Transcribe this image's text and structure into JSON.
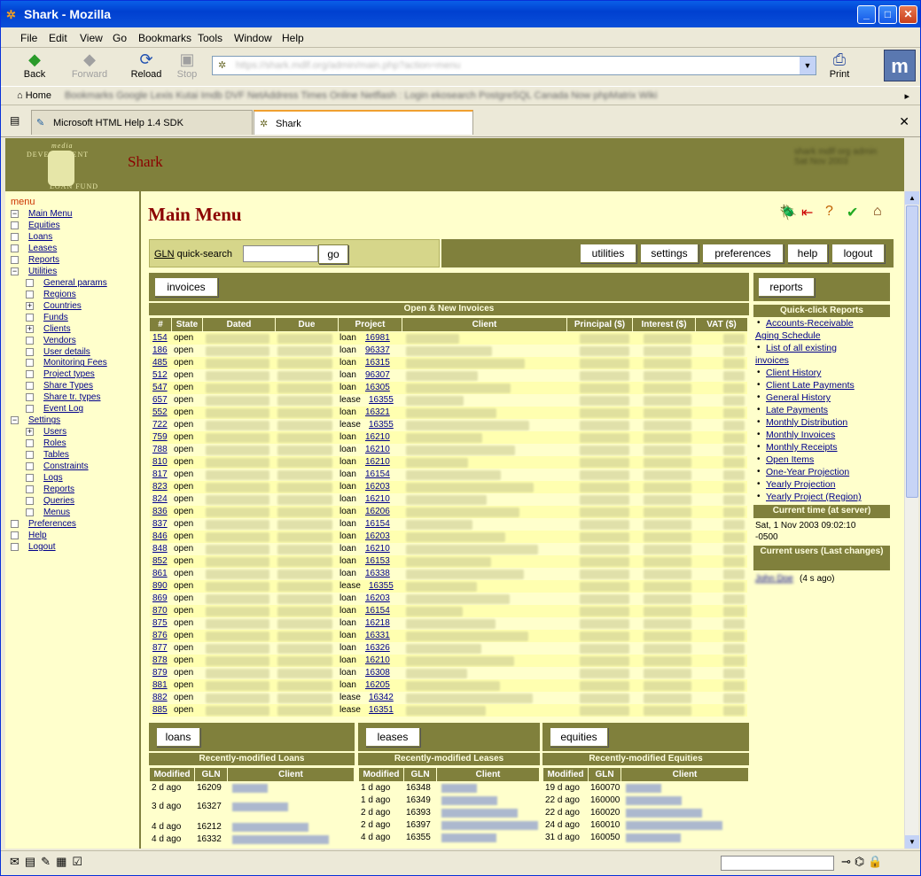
{
  "window": {
    "title": "Shark - Mozilla"
  },
  "menu": [
    "File",
    "Edit",
    "View",
    "Go",
    "Bookmarks",
    "Tools",
    "Window",
    "Help"
  ],
  "nav": {
    "back": "Back",
    "forward": "Forward",
    "reload": "Reload",
    "stop": "Stop",
    "print": "Print",
    "url": "https://shark.mdlf.org/admin/main.php?action=menu"
  },
  "bookmarks": {
    "home": "Home",
    "items": "Bookmarks  Google  Lexis  Kutai  Imdb  DVF  NetAddress  Times Online  Netflash : Login  ekosearch  PostgreSQL  Canada Now  phpMatrix  Wiki"
  },
  "tabs": [
    {
      "label": "Microsoft HTML Help 1.4 SDK"
    },
    {
      "label": "Shark"
    }
  ],
  "banner": {
    "logo_l1": "media",
    "logo_l2": "DEVELOPMENT",
    "logo_l3": "LOAN FUND",
    "app": "Shark",
    "right": "shark mdlf org  admin  Sat Nov 2003"
  },
  "sidebar": {
    "header": "menu",
    "items": [
      {
        "label": "Main Menu",
        "box": "−",
        "lvl": 0
      },
      {
        "label": "Equities",
        "box": "",
        "lvl": 0
      },
      {
        "label": "Loans",
        "box": "",
        "lvl": 0
      },
      {
        "label": "Leases",
        "box": "",
        "lvl": 0
      },
      {
        "label": "Reports",
        "box": "",
        "lvl": 0
      },
      {
        "label": "Utilities",
        "box": "−",
        "lvl": 0
      },
      {
        "label": "General params",
        "box": "",
        "lvl": 1
      },
      {
        "label": "Regions",
        "box": "",
        "lvl": 1
      },
      {
        "label": "Countries",
        "box": "+",
        "lvl": 1
      },
      {
        "label": "Funds",
        "box": "",
        "lvl": 1
      },
      {
        "label": "Clients",
        "box": "+",
        "lvl": 1
      },
      {
        "label": "Vendors",
        "box": "",
        "lvl": 1
      },
      {
        "label": "User details",
        "box": "",
        "lvl": 1
      },
      {
        "label": "Monitoring Fees",
        "box": "",
        "lvl": 1
      },
      {
        "label": "Project types",
        "box": "",
        "lvl": 1
      },
      {
        "label": "Share Types",
        "box": "",
        "lvl": 1
      },
      {
        "label": "Share tr. types",
        "box": "",
        "lvl": 1
      },
      {
        "label": "Event Log",
        "box": "",
        "lvl": 1
      },
      {
        "label": "Settings",
        "box": "−",
        "lvl": 0
      },
      {
        "label": "Users",
        "box": "+",
        "lvl": 1
      },
      {
        "label": "Roles",
        "box": "",
        "lvl": 1
      },
      {
        "label": "Tables",
        "box": "",
        "lvl": 1
      },
      {
        "label": "Constraints",
        "box": "",
        "lvl": 1
      },
      {
        "label": "Logs",
        "box": "",
        "lvl": 1
      },
      {
        "label": "Reports",
        "box": "",
        "lvl": 1
      },
      {
        "label": "Queries",
        "box": "",
        "lvl": 1
      },
      {
        "label": "Menus",
        "box": "",
        "lvl": 1
      },
      {
        "label": "Preferences",
        "box": "",
        "lvl": 0
      },
      {
        "label": "Help",
        "box": "",
        "lvl": 0
      },
      {
        "label": "Logout",
        "box": "",
        "lvl": 0
      }
    ]
  },
  "main": {
    "title": "Main Menu",
    "quicksearch": {
      "gln": "GLN",
      "label": " quick-search",
      "go": "go",
      "value": ""
    },
    "toolbar": [
      "utilities",
      "settings",
      "preferences",
      "help",
      "logout"
    ],
    "invoices": {
      "button": "invoices",
      "subtitle": "Open & New Invoices",
      "headers": [
        "#",
        "State",
        "Dated",
        "Due",
        "Project",
        "Client",
        "Principal ($)",
        "Interest ($)",
        "VAT ($)"
      ],
      "rows": [
        [
          "154",
          "open",
          "loan",
          "16981"
        ],
        [
          "186",
          "open",
          "loan",
          "96337"
        ],
        [
          "485",
          "open",
          "loan",
          "16315"
        ],
        [
          "512",
          "open",
          "loan",
          "96307"
        ],
        [
          "547",
          "open",
          "loan",
          "16305"
        ],
        [
          "657",
          "open",
          "lease",
          "16355"
        ],
        [
          "552",
          "open",
          "loan",
          "16321"
        ],
        [
          "722",
          "open",
          "lease",
          "16355"
        ],
        [
          "759",
          "open",
          "loan",
          "16210"
        ],
        [
          "788",
          "open",
          "loan",
          "16210"
        ],
        [
          "810",
          "open",
          "loan",
          "16210"
        ],
        [
          "817",
          "open",
          "loan",
          "16154"
        ],
        [
          "823",
          "open",
          "loan",
          "16203"
        ],
        [
          "824",
          "open",
          "loan",
          "16210"
        ],
        [
          "836",
          "open",
          "loan",
          "16206"
        ],
        [
          "837",
          "open",
          "loan",
          "16154"
        ],
        [
          "846",
          "open",
          "loan",
          "16203"
        ],
        [
          "848",
          "open",
          "loan",
          "16210"
        ],
        [
          "852",
          "open",
          "loan",
          "16153"
        ],
        [
          "861",
          "open",
          "loan",
          "16338"
        ],
        [
          "890",
          "open",
          "lease",
          "16355"
        ],
        [
          "869",
          "open",
          "loan",
          "16203"
        ],
        [
          "870",
          "open",
          "loan",
          "16154"
        ],
        [
          "875",
          "open",
          "loan",
          "16218"
        ],
        [
          "876",
          "open",
          "loan",
          "16331"
        ],
        [
          "877",
          "open",
          "loan",
          "16326"
        ],
        [
          "878",
          "open",
          "loan",
          "16210"
        ],
        [
          "879",
          "open",
          "loan",
          "16308"
        ],
        [
          "881",
          "open",
          "loan",
          "16205"
        ],
        [
          "882",
          "open",
          "lease",
          "16342"
        ],
        [
          "885",
          "open",
          "lease",
          "16351"
        ]
      ]
    },
    "reports": {
      "button": "reports",
      "subtitle": "Quick-click Reports",
      "links": [
        "Accounts-Receivable",
        "Aging Schedule",
        "List of all existing",
        "invoices",
        "Client History",
        "Client Late Payments",
        "General History",
        "Late Payments",
        "Monthly Distribution",
        "Monthly Invoices",
        "Monthly Receipts",
        "Open Items",
        "One-Year Projection",
        "Yearly Projection",
        "Yearly Project (Region)"
      ],
      "time_hd": "Current time (at server)",
      "time": "Sat, 1 Nov 2003 09:02:10",
      "tz": "-0500",
      "users_hd": "Current users (Last changes)",
      "user": "John Doe",
      "user_ago": " (4 s ago)"
    },
    "loans": {
      "button": "loans",
      "subtitle": "Recently-modified Loans",
      "headers": [
        "Modified",
        "GLN",
        "Client"
      ],
      "rows": [
        [
          "2 d ago",
          "16209"
        ],
        [
          "3 d ago",
          "16327"
        ],
        [
          "4 d ago",
          "16212"
        ],
        [
          "4 d ago",
          "16332"
        ]
      ]
    },
    "leases": {
      "button": "leases",
      "subtitle": "Recently-modified Leases",
      "headers": [
        "Modified",
        "GLN",
        "Client"
      ],
      "rows": [
        [
          "1 d ago",
          "16348"
        ],
        [
          "1 d ago",
          "16349"
        ],
        [
          "2 d ago",
          "16393"
        ],
        [
          "2 d ago",
          "16397"
        ],
        [
          "4 d ago",
          "16355"
        ]
      ]
    },
    "equities": {
      "button": "equities",
      "subtitle": "Recently-modified Equities",
      "headers": [
        "Modified",
        "GLN",
        "Client"
      ],
      "rows": [
        [
          "19 d ago",
          "160070"
        ],
        [
          "22 d ago",
          "160000"
        ],
        [
          "22 d ago",
          "160020"
        ],
        [
          "24 d ago",
          "160010"
        ],
        [
          "31 d ago",
          "160050"
        ]
      ]
    }
  }
}
